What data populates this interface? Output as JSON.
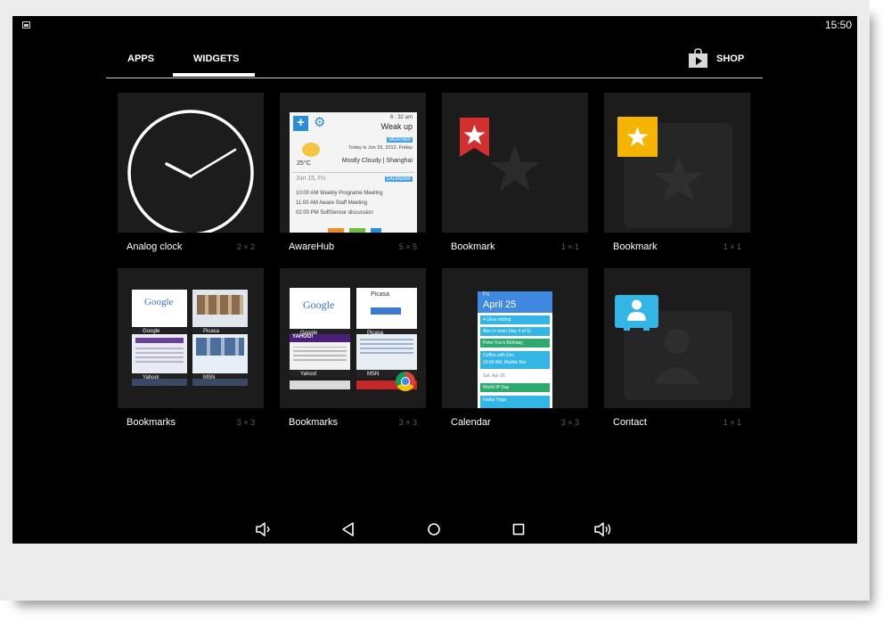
{
  "status_bar": {
    "time": "15:50"
  },
  "tabs": [
    {
      "label": "APPS"
    },
    {
      "label": "WIDGETS"
    }
  ],
  "shop": {
    "label": "SHOP"
  },
  "colors": {
    "background": "#000000",
    "tile_background": "#1c1c1c",
    "active_tab_underline": "#ffffff",
    "bookmark_red": "#d32f2f",
    "bookmark_yellow": "#f4b400",
    "contact_blue": "#33b5e5",
    "calendar_blue": "#3f8ae0"
  },
  "widgets": [
    {
      "name": "Analog clock",
      "size": "2 × 2",
      "icon": "analog-clock-face"
    },
    {
      "name": "AwareHub",
      "size": "5 × 5",
      "icon": "awarehub-preview",
      "preview": {
        "time": "6 : 32 am",
        "alarm": "Weak up",
        "weather_badge": "WEATHER",
        "temperature": "25°C",
        "today": "Today is Jun 15, 2012, Friday",
        "weather": "Mostly Cloudy | Shanghai",
        "date": "Jun 15, Fri",
        "calendar_badge": "CALENDAR",
        "events": [
          "10:00 AM Weekly Programe Meeting",
          "11:00 AM Aware Staff Meeting",
          "02:00 PM SoftSensor discussion"
        ]
      }
    },
    {
      "name": "Bookmark",
      "size": "1 × 1",
      "icon": "bookmark-red-star-icon"
    },
    {
      "name": "Bookmark",
      "size": "1 × 1",
      "icon": "bookmark-yellow-star-icon"
    },
    {
      "name": "Bookmarks",
      "size": "3 × 3",
      "icon": "bookmarks-grid-preview",
      "thumbs": [
        "Google",
        "Picasa",
        "Yahoo!",
        "MSN"
      ]
    },
    {
      "name": "Bookmarks",
      "size": "3 × 3",
      "icon": "bookmarks-stack-preview",
      "thumbs": [
        "Google",
        "Picasa",
        "Yahoo!",
        "MSN"
      ],
      "picasa_logo": "Picasa",
      "yahoo_logo": "YAHOO!"
    },
    {
      "name": "Calendar",
      "size": "3 × 3",
      "icon": "calendar-preview",
      "preview": {
        "weekday": "Fri",
        "date": "April 25",
        "events": [
          "4 Gina visiting",
          "Alex in town (day 4 of 5)",
          "Peter Fox's Birthday",
          "Coffee with Eric",
          "10:00 AM, Marble Bar"
        ],
        "day2": "Sat, Apr 26",
        "events2": [
          "World IP Day",
          "Hatha Yoga"
        ]
      }
    },
    {
      "name": "Contact",
      "size": "1 × 1",
      "icon": "contact-card-icon"
    }
  ],
  "nav_bar": {
    "buttons": [
      "volume-down-icon",
      "back-icon",
      "home-icon",
      "recents-icon",
      "volume-up-icon"
    ]
  }
}
